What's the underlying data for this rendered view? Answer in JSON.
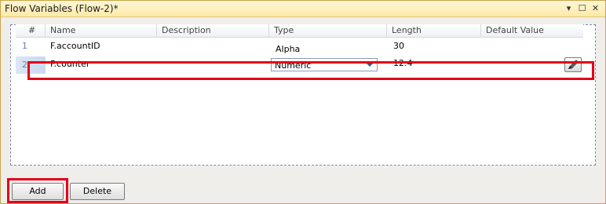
{
  "window": {
    "title": "Flow Variables (Flow-2)*"
  },
  "window_controls": {
    "pin": "▾",
    "maximize": "☐",
    "close": "✕"
  },
  "grid": {
    "columns": [
      "#",
      "Name",
      "Description",
      "Type",
      "Length",
      "Default Value"
    ],
    "rows": [
      {
        "num": "1",
        "name": "F.accountID",
        "description": "",
        "type": "Alpha",
        "length": "30",
        "default": ""
      },
      {
        "num": "2",
        "name": "F.counter",
        "description": "",
        "type": "Numeric",
        "length": "12.4",
        "default": ""
      }
    ]
  },
  "buttons": {
    "add": "Add",
    "delete": "Delete"
  },
  "colors": {
    "highlight": "#e2001a",
    "title_bg": "#fde9a8"
  }
}
